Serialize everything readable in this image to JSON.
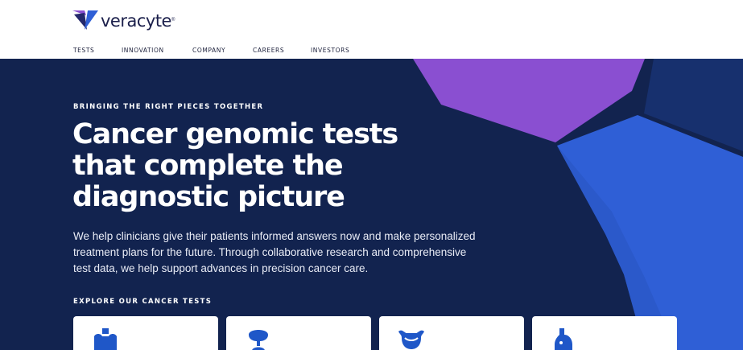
{
  "brand": {
    "name": "veracyte",
    "reg_mark": "®"
  },
  "nav": {
    "items": [
      {
        "label": "TESTS"
      },
      {
        "label": "INNOVATION"
      },
      {
        "label": "COMPANY"
      },
      {
        "label": "CAREERS"
      },
      {
        "label": "INVESTORS"
      }
    ]
  },
  "hero": {
    "eyebrow": "BRINGING THE RIGHT PIECES TOGETHER",
    "headline": "Cancer genomic tests that complete the diagnostic picture",
    "intro": "We help clinicians give their patients informed answers now and make personalized treatment plans for the future. Through collaborative research and comprehensive test data, we help support advances in precision cancer care.",
    "tests_label": "EXPLORE OUR CANCER TESTS"
  },
  "test_cards": [
    {
      "icon": "thyroid-icon"
    },
    {
      "icon": "lung-icon"
    },
    {
      "icon": "bladder-icon"
    },
    {
      "icon": "breast-icon"
    }
  ],
  "colors": {
    "hero_background": "#12234f",
    "accent_purple": "#8a4fd1",
    "accent_blue": "#2f5fd6",
    "icon_blue": "#1f57c8",
    "logo_navy": "#1b1f4b"
  }
}
